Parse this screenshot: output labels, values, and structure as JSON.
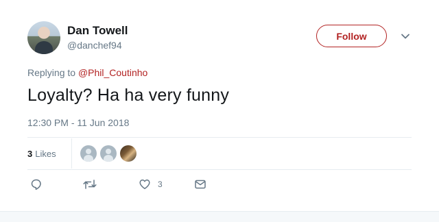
{
  "tweet": {
    "author_name": "Dan Towell",
    "author_handle": "@danchef94",
    "follow_label": "Follow",
    "replying_to_prefix": "Replying to",
    "replying_to_mention": "@Phil_Coutinho",
    "text": "Loyalty? Ha ha very funny",
    "timestamp": "12:30 PM - 11 Jun 2018"
  },
  "stats": {
    "likes_count": "3",
    "likes_label": "Likes"
  },
  "actions": {
    "like_count": "3",
    "icons": [
      "reply-icon",
      "retweet-icon",
      "heart-icon",
      "direct-message-icon"
    ]
  },
  "colors": {
    "accent": "#b22222",
    "secondary_text": "#657786",
    "primary_text": "#14171a",
    "divider": "#e6ecf0"
  }
}
